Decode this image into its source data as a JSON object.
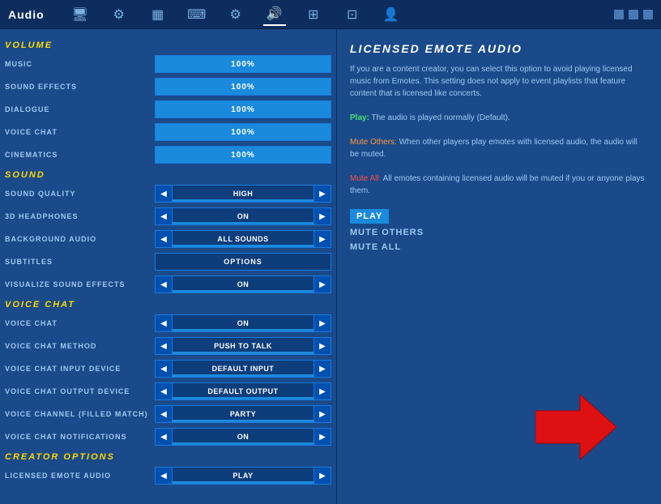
{
  "titleBar": {
    "title": "Audio",
    "icons": [
      {
        "name": "monitor-icon",
        "symbol": "🖥",
        "active": false
      },
      {
        "name": "settings-icon",
        "symbol": "⚙",
        "active": false
      },
      {
        "name": "display-icon",
        "symbol": "📺",
        "active": false
      },
      {
        "name": "keyboard-icon",
        "symbol": "⌨",
        "active": false
      },
      {
        "name": "controller-icon",
        "symbol": "🎮",
        "active": false
      },
      {
        "name": "audio-icon",
        "symbol": "🔊",
        "active": true
      },
      {
        "name": "network-icon",
        "symbol": "⊞",
        "active": false
      },
      {
        "name": "gamepad-icon",
        "symbol": "🎮",
        "active": false
      },
      {
        "name": "user-icon",
        "symbol": "👤",
        "active": false
      }
    ]
  },
  "leftPanel": {
    "sections": [
      {
        "id": "volume",
        "header": "VOLUME",
        "rows": [
          {
            "label": "MUSIC",
            "type": "volume",
            "value": "100%",
            "fillPct": 100
          },
          {
            "label": "SOUND EFFECTS",
            "type": "volume",
            "value": "100%",
            "fillPct": 100
          },
          {
            "label": "DIALOGUE",
            "type": "volume",
            "value": "100%",
            "fillPct": 100
          },
          {
            "label": "VOICE CHAT",
            "type": "volume",
            "value": "100%",
            "fillPct": 100
          },
          {
            "label": "CINEMATICS",
            "type": "volume",
            "value": "100%",
            "fillPct": 100
          }
        ]
      },
      {
        "id": "sound",
        "header": "SOUND",
        "rows": [
          {
            "label": "SOUND QUALITY",
            "type": "arrow",
            "value": "HIGH"
          },
          {
            "label": "3D HEADPHONES",
            "type": "arrow",
            "value": "ON"
          },
          {
            "label": "BACKGROUND AUDIO",
            "type": "arrow",
            "value": "ALL SOUNDS"
          },
          {
            "label": "SUBTITLES",
            "type": "options",
            "value": "OPTIONS"
          },
          {
            "label": "VISUALIZE SOUND EFFECTS",
            "type": "arrow",
            "value": "ON"
          }
        ]
      },
      {
        "id": "voicechat",
        "header": "VOICE CHAT",
        "rows": [
          {
            "label": "VOICE CHAT",
            "type": "arrow",
            "value": "ON"
          },
          {
            "label": "VOICE CHAT METHOD",
            "type": "arrow",
            "value": "PUSH TO TALK"
          },
          {
            "label": "VOICE CHAT INPUT DEVICE",
            "type": "arrow",
            "value": "DEFAULT INPUT"
          },
          {
            "label": "VOICE CHAT OUTPUT DEVICE",
            "type": "arrow",
            "value": "DEFAULT OUTPUT"
          },
          {
            "label": "VOICE CHANNEL (FILLED MATCH)",
            "type": "arrow",
            "value": "PARTY"
          },
          {
            "label": "VOICE CHAT NOTIFICATIONS",
            "type": "arrow",
            "value": "ON"
          }
        ]
      },
      {
        "id": "creator",
        "header": "CREATOR OPTIONS",
        "rows": [
          {
            "label": "LICENSED EMOTE AUDIO",
            "type": "arrow",
            "value": "PLAY"
          }
        ]
      }
    ]
  },
  "rightPanel": {
    "title": "LICENSED EMOTE AUDIO",
    "description1": "If you are a content creator, you can select this option to avoid playing licensed music from Emotes. This setting does not apply to event playlists that feature content that is licensed like concerts.",
    "play_label": "Play:",
    "play_desc": "The audio is played normally (Default).",
    "mute_others_label": "Mute Others:",
    "mute_others_desc": "When other players play emotes with licensed audio, the audio will be muted.",
    "mute_all_label": "Mute All:",
    "mute_all_desc": "All emotes containing licensed audio will be muted if you or anyone plays them.",
    "options": [
      {
        "label": "PLAY",
        "selected": true
      },
      {
        "label": "MUTE OTHERS",
        "selected": false
      },
      {
        "label": "MUTE ALL",
        "selected": false
      }
    ]
  }
}
